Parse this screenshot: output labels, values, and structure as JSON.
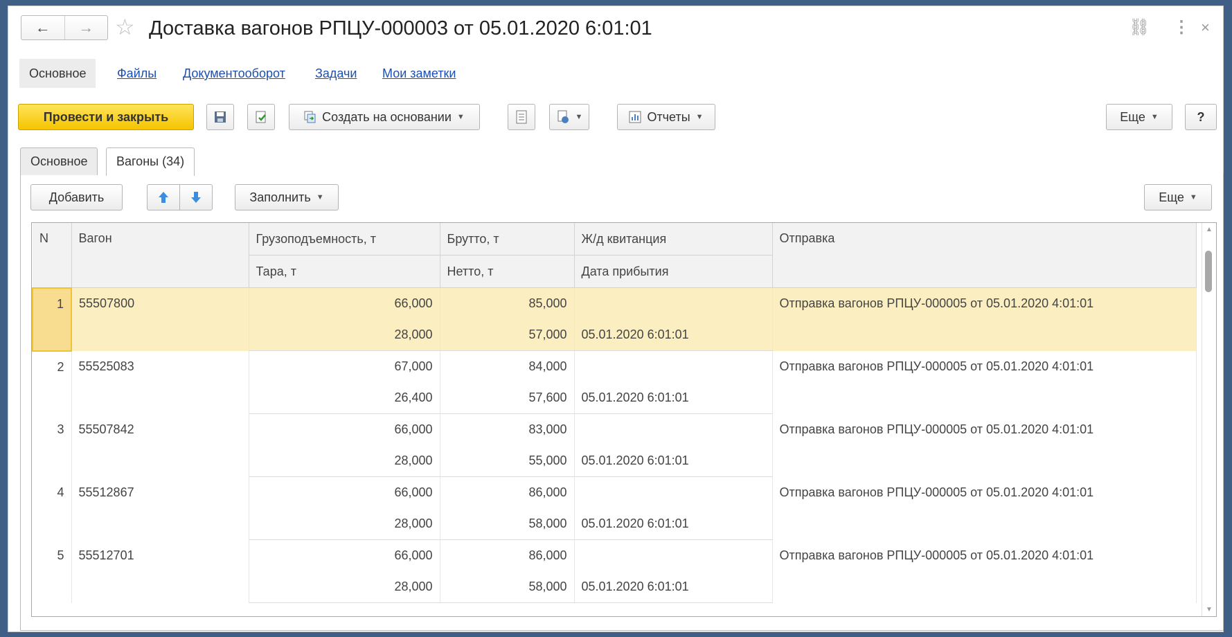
{
  "window": {
    "title": "Доставка вагонов РПЦУ-000003 от 05.01.2020 6:01:01",
    "nav": {
      "back": "←",
      "forward": "→",
      "star": "☆"
    },
    "icons": {
      "link": "link-icon",
      "menu": "more-icon",
      "close": "close-icon"
    },
    "link_glyph": "⛓",
    "menu_glyph": "⋮",
    "close_glyph": "×"
  },
  "sections": [
    {
      "label": "Основное",
      "active": true
    },
    {
      "label": "Файлы"
    },
    {
      "label": "Документооборот"
    },
    {
      "label": "Задачи"
    },
    {
      "label": "Мои заметки"
    }
  ],
  "toolbar": {
    "post_close": "Провести и закрыть",
    "create_based": "Создать на основании",
    "reports": "Отчеты",
    "more": "Еще",
    "help": "?"
  },
  "tabs": [
    {
      "label": "Основное"
    },
    {
      "label": "Вагоны (34)",
      "active": true
    }
  ],
  "grid_toolbar": {
    "add": "Добавить",
    "fill": "Заполнить",
    "more": "Еще"
  },
  "table": {
    "headers": {
      "n": "N",
      "wagon": "Вагон",
      "capacity": "Грузоподъемность, т",
      "tare": "Тара, т",
      "gross": "Брутто, т",
      "net": "Нетто, т",
      "receipt": "Ж/д квитанция",
      "arrival": "Дата прибытия",
      "shipment": "Отправка"
    },
    "rows": [
      {
        "n": "1",
        "wagon": "55507800",
        "capacity": "66,000",
        "tare": "28,000",
        "gross": "85,000",
        "net": "57,000",
        "receipt": "",
        "arrival": "05.01.2020 6:01:01",
        "shipment": "Отправка вагонов РПЦУ-000005 от 05.01.2020 4:01:01"
      },
      {
        "n": "2",
        "wagon": "55525083",
        "capacity": "67,000",
        "tare": "26,400",
        "gross": "84,000",
        "net": "57,600",
        "receipt": "",
        "arrival": "05.01.2020 6:01:01",
        "shipment": "Отправка вагонов РПЦУ-000005 от 05.01.2020 4:01:01"
      },
      {
        "n": "3",
        "wagon": "55507842",
        "capacity": "66,000",
        "tare": "28,000",
        "gross": "83,000",
        "net": "55,000",
        "receipt": "",
        "arrival": "05.01.2020 6:01:01",
        "shipment": "Отправка вагонов РПЦУ-000005 от 05.01.2020 4:01:01"
      },
      {
        "n": "4",
        "wagon": "55512867",
        "capacity": "66,000",
        "tare": "28,000",
        "gross": "86,000",
        "net": "58,000",
        "receipt": "",
        "arrival": "05.01.2020 6:01:01",
        "shipment": "Отправка вагонов РПЦУ-000005 от 05.01.2020 4:01:01"
      },
      {
        "n": "5",
        "wagon": "55512701",
        "capacity": "66,000",
        "tare": "28,000",
        "gross": "86,000",
        "net": "58,000",
        "receipt": "",
        "arrival": "05.01.2020 6:01:01",
        "shipment": "Отправка вагонов РПЦУ-000005 от 05.01.2020 4:01:01"
      }
    ]
  }
}
